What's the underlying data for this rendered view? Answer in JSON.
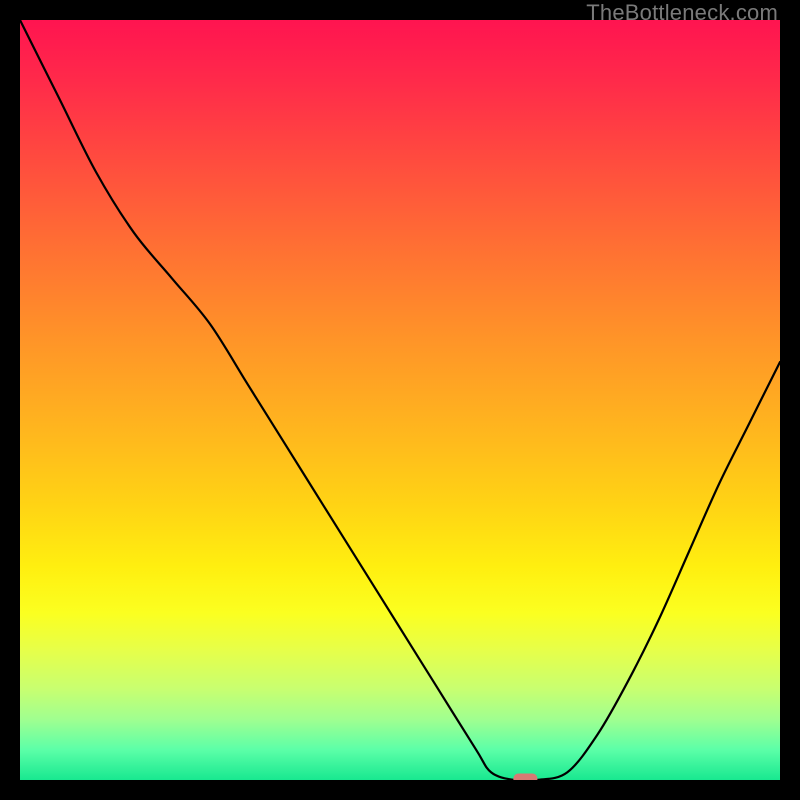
{
  "watermark": {
    "text": "TheBottleneck.com"
  },
  "colors": {
    "background": "#000000",
    "curve": "#000000",
    "marker": "#d77a74",
    "gradient_top": "#ff1450",
    "gradient_bottom": "#18e890"
  },
  "chart_data": {
    "type": "line",
    "title": "",
    "xlabel": "",
    "ylabel": "",
    "xlim": [
      0,
      100
    ],
    "ylim": [
      0,
      100
    ],
    "grid": false,
    "legend": false,
    "note": "Axis values are normalized 0–100 (no tick labels shown in source image); curve points are visual estimates from the plot.",
    "series": [
      {
        "name": "curve",
        "x": [
          0,
          5,
          10,
          15,
          20,
          25,
          30,
          35,
          40,
          45,
          50,
          55,
          60,
          62,
          65,
          68,
          72,
          76,
          80,
          84,
          88,
          92,
          96,
          100
        ],
        "y": [
          100,
          90,
          80,
          72,
          66,
          60,
          52,
          44,
          36,
          28,
          20,
          12,
          4,
          1,
          0,
          0,
          1,
          6,
          13,
          21,
          30,
          39,
          47,
          55
        ]
      }
    ],
    "marker": {
      "x": 66.5,
      "y": 0,
      "shape": "rounded-rect"
    }
  }
}
